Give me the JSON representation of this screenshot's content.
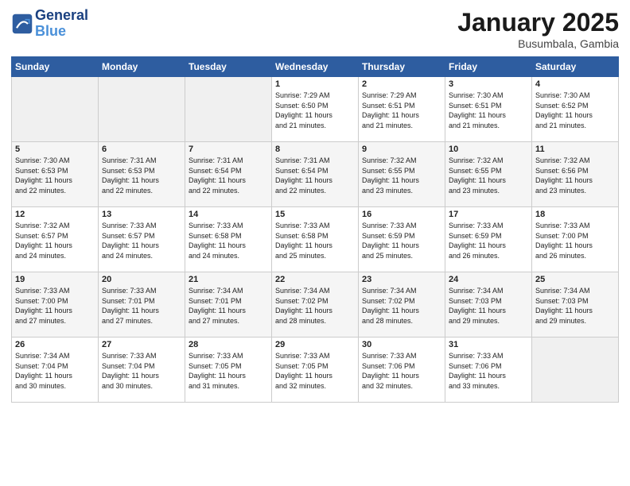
{
  "header": {
    "logo_line1": "General",
    "logo_line2": "Blue",
    "month": "January 2025",
    "location": "Busumbala, Gambia"
  },
  "weekdays": [
    "Sunday",
    "Monday",
    "Tuesday",
    "Wednesday",
    "Thursday",
    "Friday",
    "Saturday"
  ],
  "weeks": [
    [
      {
        "day": "",
        "content": ""
      },
      {
        "day": "",
        "content": ""
      },
      {
        "day": "",
        "content": ""
      },
      {
        "day": "1",
        "content": "Sunrise: 7:29 AM\nSunset: 6:50 PM\nDaylight: 11 hours\nand 21 minutes."
      },
      {
        "day": "2",
        "content": "Sunrise: 7:29 AM\nSunset: 6:51 PM\nDaylight: 11 hours\nand 21 minutes."
      },
      {
        "day": "3",
        "content": "Sunrise: 7:30 AM\nSunset: 6:51 PM\nDaylight: 11 hours\nand 21 minutes."
      },
      {
        "day": "4",
        "content": "Sunrise: 7:30 AM\nSunset: 6:52 PM\nDaylight: 11 hours\nand 21 minutes."
      }
    ],
    [
      {
        "day": "5",
        "content": "Sunrise: 7:30 AM\nSunset: 6:53 PM\nDaylight: 11 hours\nand 22 minutes."
      },
      {
        "day": "6",
        "content": "Sunrise: 7:31 AM\nSunset: 6:53 PM\nDaylight: 11 hours\nand 22 minutes."
      },
      {
        "day": "7",
        "content": "Sunrise: 7:31 AM\nSunset: 6:54 PM\nDaylight: 11 hours\nand 22 minutes."
      },
      {
        "day": "8",
        "content": "Sunrise: 7:31 AM\nSunset: 6:54 PM\nDaylight: 11 hours\nand 22 minutes."
      },
      {
        "day": "9",
        "content": "Sunrise: 7:32 AM\nSunset: 6:55 PM\nDaylight: 11 hours\nand 23 minutes."
      },
      {
        "day": "10",
        "content": "Sunrise: 7:32 AM\nSunset: 6:55 PM\nDaylight: 11 hours\nand 23 minutes."
      },
      {
        "day": "11",
        "content": "Sunrise: 7:32 AM\nSunset: 6:56 PM\nDaylight: 11 hours\nand 23 minutes."
      }
    ],
    [
      {
        "day": "12",
        "content": "Sunrise: 7:32 AM\nSunset: 6:57 PM\nDaylight: 11 hours\nand 24 minutes."
      },
      {
        "day": "13",
        "content": "Sunrise: 7:33 AM\nSunset: 6:57 PM\nDaylight: 11 hours\nand 24 minutes."
      },
      {
        "day": "14",
        "content": "Sunrise: 7:33 AM\nSunset: 6:58 PM\nDaylight: 11 hours\nand 24 minutes."
      },
      {
        "day": "15",
        "content": "Sunrise: 7:33 AM\nSunset: 6:58 PM\nDaylight: 11 hours\nand 25 minutes."
      },
      {
        "day": "16",
        "content": "Sunrise: 7:33 AM\nSunset: 6:59 PM\nDaylight: 11 hours\nand 25 minutes."
      },
      {
        "day": "17",
        "content": "Sunrise: 7:33 AM\nSunset: 6:59 PM\nDaylight: 11 hours\nand 26 minutes."
      },
      {
        "day": "18",
        "content": "Sunrise: 7:33 AM\nSunset: 7:00 PM\nDaylight: 11 hours\nand 26 minutes."
      }
    ],
    [
      {
        "day": "19",
        "content": "Sunrise: 7:33 AM\nSunset: 7:00 PM\nDaylight: 11 hours\nand 27 minutes."
      },
      {
        "day": "20",
        "content": "Sunrise: 7:33 AM\nSunset: 7:01 PM\nDaylight: 11 hours\nand 27 minutes."
      },
      {
        "day": "21",
        "content": "Sunrise: 7:34 AM\nSunset: 7:01 PM\nDaylight: 11 hours\nand 27 minutes."
      },
      {
        "day": "22",
        "content": "Sunrise: 7:34 AM\nSunset: 7:02 PM\nDaylight: 11 hours\nand 28 minutes."
      },
      {
        "day": "23",
        "content": "Sunrise: 7:34 AM\nSunset: 7:02 PM\nDaylight: 11 hours\nand 28 minutes."
      },
      {
        "day": "24",
        "content": "Sunrise: 7:34 AM\nSunset: 7:03 PM\nDaylight: 11 hours\nand 29 minutes."
      },
      {
        "day": "25",
        "content": "Sunrise: 7:34 AM\nSunset: 7:03 PM\nDaylight: 11 hours\nand 29 minutes."
      }
    ],
    [
      {
        "day": "26",
        "content": "Sunrise: 7:34 AM\nSunset: 7:04 PM\nDaylight: 11 hours\nand 30 minutes."
      },
      {
        "day": "27",
        "content": "Sunrise: 7:33 AM\nSunset: 7:04 PM\nDaylight: 11 hours\nand 30 minutes."
      },
      {
        "day": "28",
        "content": "Sunrise: 7:33 AM\nSunset: 7:05 PM\nDaylight: 11 hours\nand 31 minutes."
      },
      {
        "day": "29",
        "content": "Sunrise: 7:33 AM\nSunset: 7:05 PM\nDaylight: 11 hours\nand 32 minutes."
      },
      {
        "day": "30",
        "content": "Sunrise: 7:33 AM\nSunset: 7:06 PM\nDaylight: 11 hours\nand 32 minutes."
      },
      {
        "day": "31",
        "content": "Sunrise: 7:33 AM\nSunset: 7:06 PM\nDaylight: 11 hours\nand 33 minutes."
      },
      {
        "day": "",
        "content": ""
      }
    ]
  ]
}
